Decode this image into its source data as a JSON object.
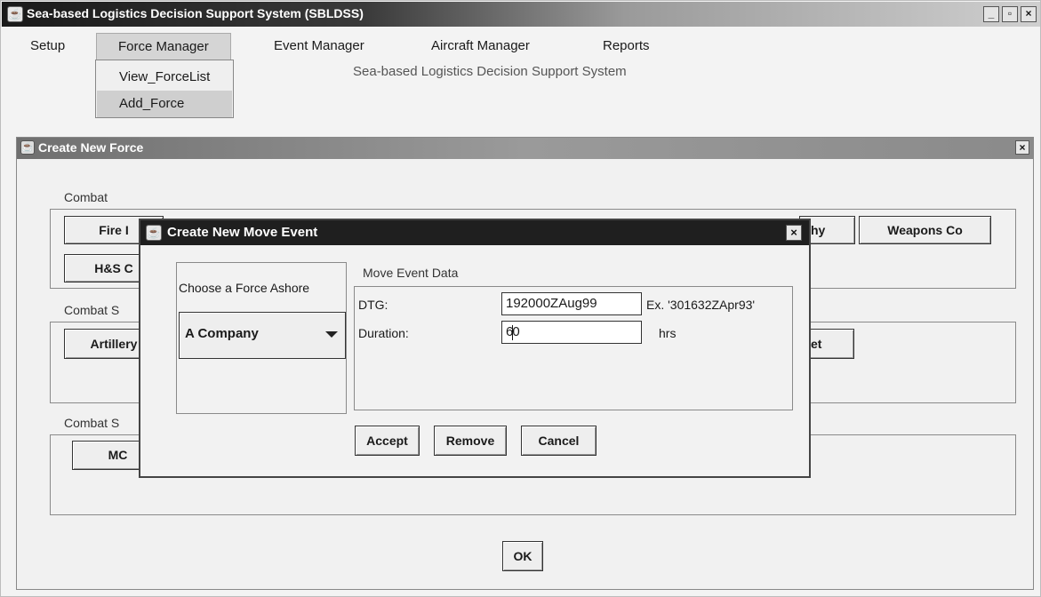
{
  "window": {
    "title": "Sea-based Logistics Decision Support System (SBLDSS)"
  },
  "menubar": {
    "items": [
      "Setup",
      "Force Manager",
      "Event Manager",
      "Aircraft Manager",
      "Reports"
    ]
  },
  "dropdown": {
    "items": [
      "View_ForceList",
      "Add_Force"
    ]
  },
  "watermark": "Sea-based Logistics Decision Support System",
  "create_force": {
    "title": "Create New Force",
    "groups": {
      "combat": {
        "label": "Combat",
        "buttons": [
          "Fire I",
          "H&S C",
          "hy",
          "Weapons Co"
        ]
      },
      "combat_support": {
        "label": "Combat S",
        "buttons": [
          "Artillery",
          "et"
        ]
      },
      "combat_service": {
        "label": "Combat S",
        "buttons": [
          "MC"
        ]
      }
    },
    "ok_label": "OK"
  },
  "move_event": {
    "title": "Create New Move Event",
    "choose_label": "Choose a Force Ashore",
    "force_selected": "A Company",
    "data_label": "Move Event Data",
    "dtg_label": "DTG:",
    "dtg_value": "192000ZAug99",
    "dtg_example": "Ex. '301632ZApr93'",
    "duration_label": "Duration:",
    "duration_value_a": "6",
    "duration_value_b": "0",
    "duration_unit": "hrs",
    "buttons": {
      "accept": "Accept",
      "remove": "Remove",
      "cancel": "Cancel"
    }
  }
}
